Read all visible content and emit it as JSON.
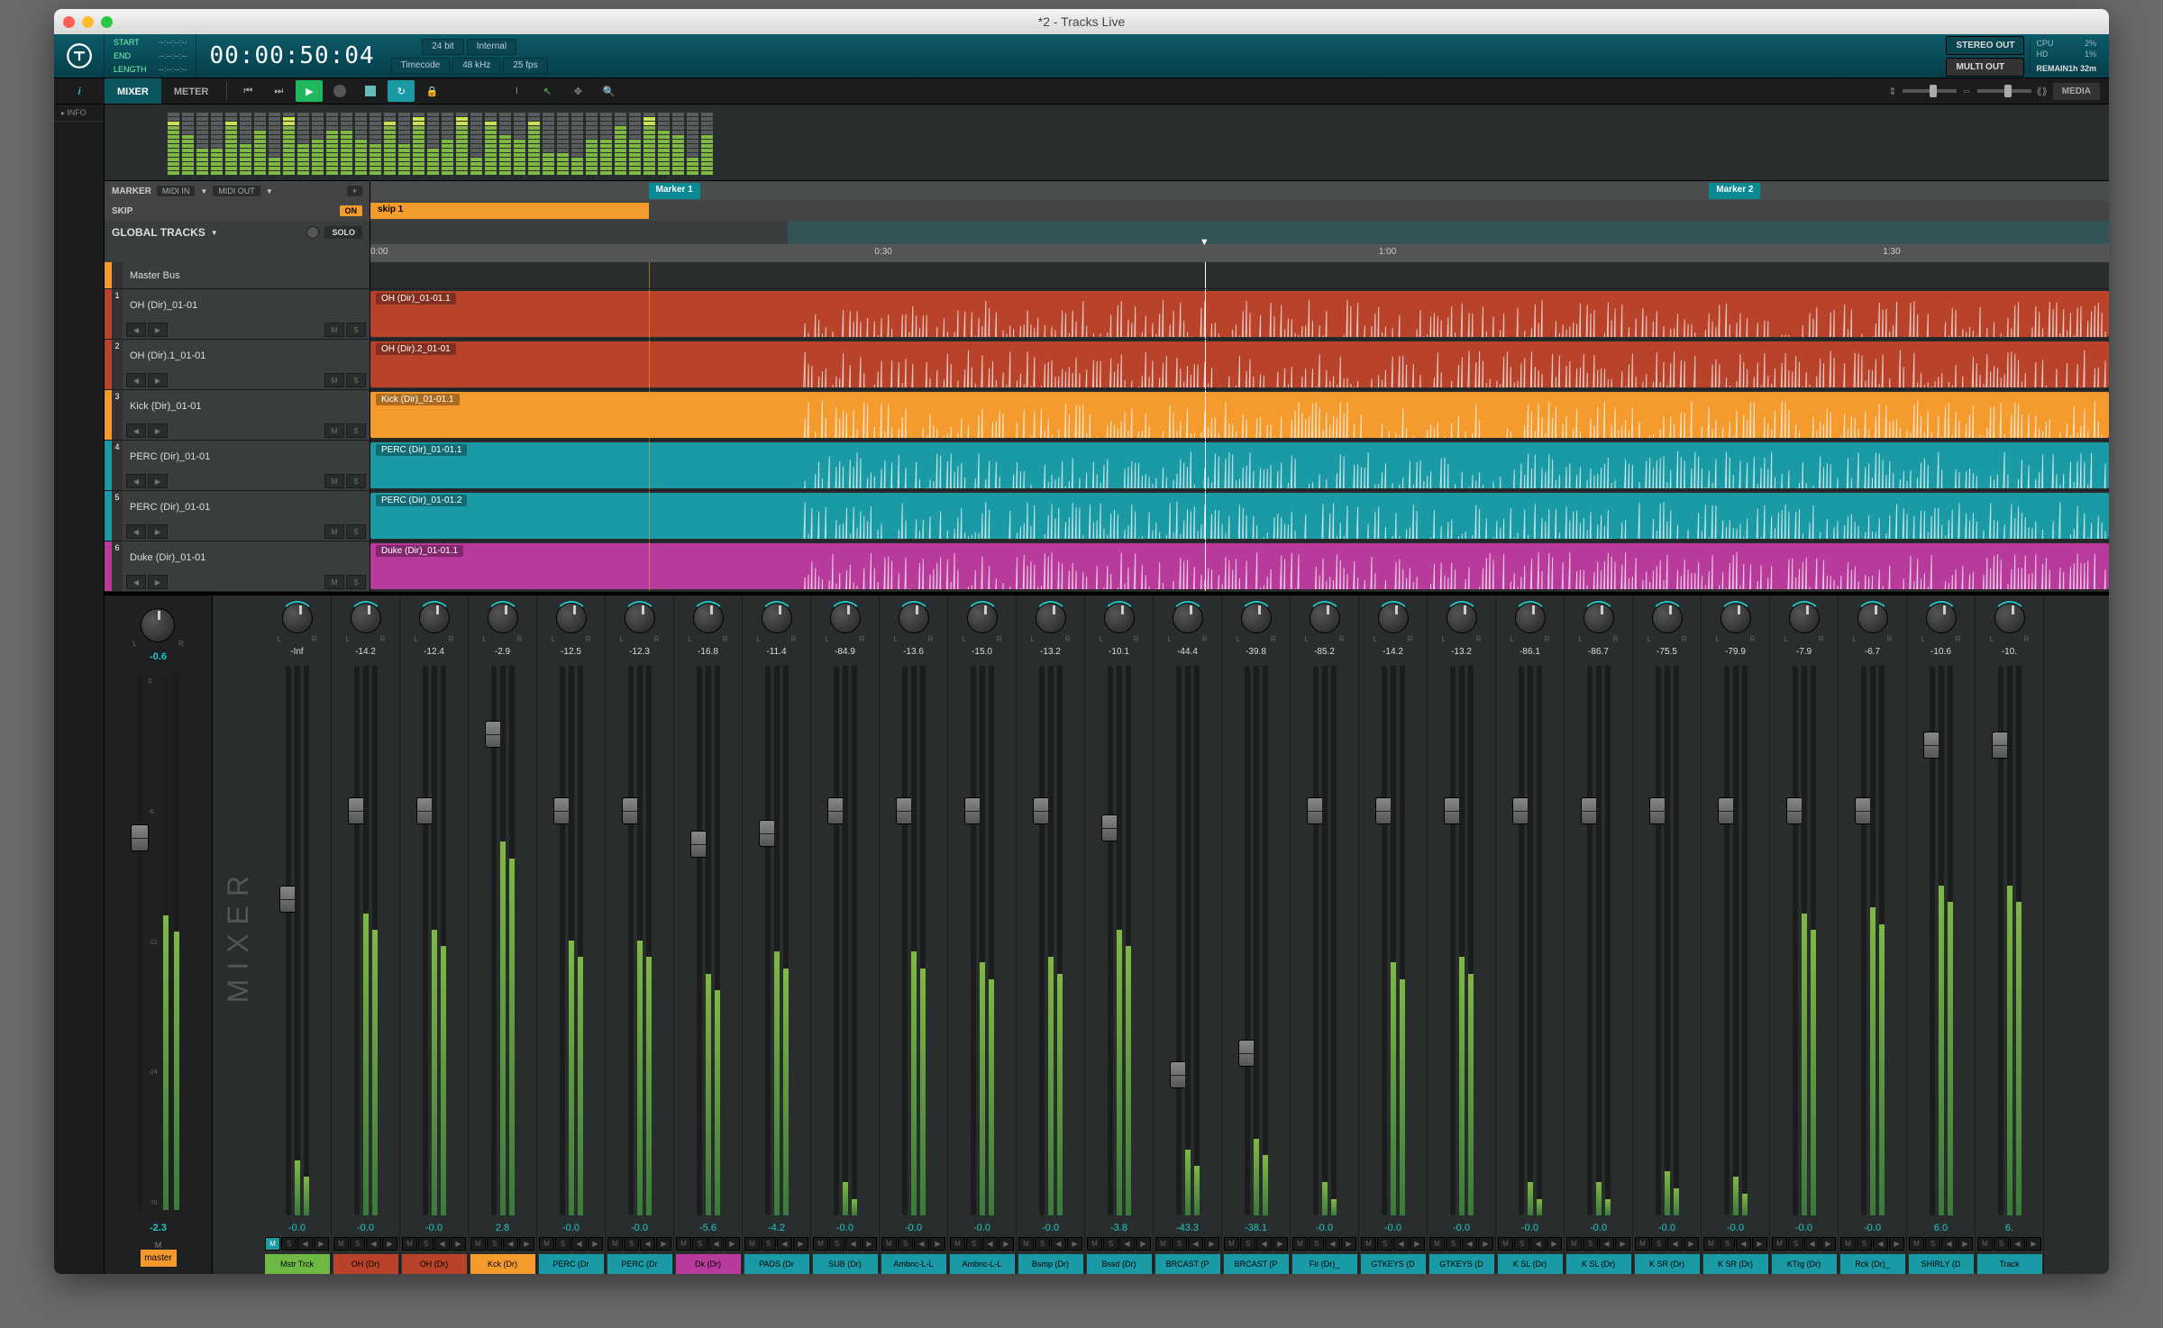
{
  "window": {
    "title": "*2 - Tracks Live"
  },
  "transport": {
    "start_label": "START",
    "start": "--:--:--:--",
    "end_label": "END",
    "end": "--:--:--:--",
    "length_label": "LENGTH",
    "length": "--:--:--:--",
    "timecode": "00:00:50:04",
    "bit": "24 bit",
    "clock": "Internal",
    "tc_label": "Timecode",
    "rate": "48 kHz",
    "fps": "25 fps",
    "stereo": "STEREO OUT",
    "multi": "MULTI OUT",
    "cpu_label": "CPU",
    "cpu": "2%",
    "hd_label": "HD",
    "hd": "1%",
    "remain_label": "REMAIN",
    "remain": "1h 32m"
  },
  "tabs": {
    "info": "INFO",
    "mixer": "MIXER",
    "meter": "METER",
    "media": "MEDIA"
  },
  "timeline": {
    "marker_label": "MARKER",
    "midi_in": "MIDI IN",
    "midi_out": "MIDI OUT",
    "skip_label": "SKIP",
    "on": "ON",
    "skip1": "skip 1",
    "global": "GLOBAL TRACKS",
    "solo": "SOLO",
    "markers": [
      {
        "label": "Marker 1",
        "pos": 16
      },
      {
        "label": "Marker 2",
        "pos": 77
      }
    ],
    "ruler": [
      {
        "t": "0:00",
        "p": 0
      },
      {
        "t": "0:30",
        "p": 29
      },
      {
        "t": "1:00",
        "p": 58
      },
      {
        "t": "1:30",
        "p": 87
      }
    ],
    "playhead": 48,
    "region": {
      "start": 24,
      "end": 100
    },
    "skip_region": {
      "start": 0,
      "end": 16
    }
  },
  "tracks": [
    {
      "n": "",
      "name": "Master Bus",
      "color": "#f59b2e",
      "clip": "",
      "cc": "",
      "master": true
    },
    {
      "n": "1",
      "name": "OH (Dir)_01-01",
      "color": "#b8432a",
      "clip": "OH (Dir)_01-01.1",
      "cc": "#b8432a"
    },
    {
      "n": "2",
      "name": "OH (Dir).1_01-01",
      "color": "#b8432a",
      "clip": "OH (Dir).2_01-01",
      "cc": "#b8432a"
    },
    {
      "n": "3",
      "name": "Kick (Dir)_01-01",
      "color": "#f59b2e",
      "clip": "Kick (Dir)_01-01.1",
      "cc": "#f59b2e"
    },
    {
      "n": "4",
      "name": "PERC (Dir)_01-01",
      "color": "#1a9aa5",
      "clip": "PERC (Dir)_01-01.1",
      "cc": "#1a9aa5"
    },
    {
      "n": "5",
      "name": "PERC (Dir)_01-01",
      "color": "#1a9aa5",
      "clip": "PERC (Dir)_01-01.2",
      "cc": "#1a9aa5"
    },
    {
      "n": "6",
      "name": "Duke (Dir)_01-01",
      "color": "#b83a9a",
      "clip": "Duke (Dir)_01-01.1",
      "cc": "#b83a9a"
    }
  ],
  "master": {
    "pan": "-0.6",
    "fader": "-2.3",
    "m": "M",
    "label": "master"
  },
  "mixer_label": "MIXER",
  "channels": [
    {
      "db": "-Inf",
      "val": "-0.0",
      "name": "Mstr Trck",
      "color": "#6fb843",
      "m_on": true,
      "fp": 40,
      "mh": 10
    },
    {
      "db": "-14.2",
      "val": "-0.0",
      "name": "OH (Dr)",
      "color": "#b8432a",
      "fp": 24,
      "mh": 55
    },
    {
      "db": "-12.4",
      "val": "-0.0",
      "name": "OH (Dr)",
      "color": "#b8432a",
      "fp": 24,
      "mh": 52
    },
    {
      "db": "-2.9",
      "val": "2.8",
      "name": "Kck (Dr)",
      "color": "#f59b2e",
      "fp": 10,
      "mh": 68
    },
    {
      "db": "-12.5",
      "val": "-0.0",
      "name": "PERC (Dr",
      "color": "#1a9aa5",
      "fp": 24,
      "mh": 50
    },
    {
      "db": "-12.3",
      "val": "-0.0",
      "name": "PERC (Dr",
      "color": "#1a9aa5",
      "fp": 24,
      "mh": 50
    },
    {
      "db": "-16.8",
      "val": "-5.6",
      "name": "Dk (Dr)",
      "color": "#b83a9a",
      "fp": 30,
      "mh": 44
    },
    {
      "db": "-11.4",
      "val": "-4.2",
      "name": "PADS (Dr",
      "color": "#1a9aa5",
      "fp": 28,
      "mh": 48
    },
    {
      "db": "-84.9",
      "val": "-0.0",
      "name": "SUB (Dr)",
      "color": "#1a9aa5",
      "fp": 24,
      "mh": 6
    },
    {
      "db": "-13.6",
      "val": "-0.0",
      "name": "Ambnc-L-L",
      "color": "#1a9aa5",
      "fp": 24,
      "mh": 48
    },
    {
      "db": "-15.0",
      "val": "-0.0",
      "name": "Ambnc-L-L",
      "color": "#1a9aa5",
      "fp": 24,
      "mh": 46
    },
    {
      "db": "-13.2",
      "val": "-0.0",
      "name": "Bsmp (Dr)",
      "color": "#1a9aa5",
      "fp": 24,
      "mh": 47
    },
    {
      "db": "-10.1",
      "val": "-3.8",
      "name": "Bssd (Dr)",
      "color": "#1a9aa5",
      "fp": 27,
      "mh": 52
    },
    {
      "db": "-44.4",
      "val": "-43.3",
      "name": "BRCAST (P",
      "color": "#1a9aa5",
      "fp": 72,
      "mh": 12
    },
    {
      "db": "-39.8",
      "val": "-38.1",
      "name": "BRCAST (P",
      "color": "#1a9aa5",
      "fp": 68,
      "mh": 14
    },
    {
      "db": "-85.2",
      "val": "-0.0",
      "name": "Flr (Dr)_",
      "color": "#1a9aa5",
      "fp": 24,
      "mh": 6
    },
    {
      "db": "-14.2",
      "val": "-0.0",
      "name": "GTKEYS (D",
      "color": "#1a9aa5",
      "fp": 24,
      "mh": 46
    },
    {
      "db": "-13.2",
      "val": "-0.0",
      "name": "GTKEYS (D",
      "color": "#1a9aa5",
      "fp": 24,
      "mh": 47
    },
    {
      "db": "-86.1",
      "val": "-0.0",
      "name": "K SL (Dr)",
      "color": "#1a9aa5",
      "fp": 24,
      "mh": 6
    },
    {
      "db": "-86.7",
      "val": "-0.0",
      "name": "K SL (Dr)",
      "color": "#1a9aa5",
      "fp": 24,
      "mh": 6
    },
    {
      "db": "-75.5",
      "val": "-0.0",
      "name": "K SR (Dr)",
      "color": "#1a9aa5",
      "fp": 24,
      "mh": 8
    },
    {
      "db": "-79.9",
      "val": "-0.0",
      "name": "K SR (Dr)",
      "color": "#1a9aa5",
      "fp": 24,
      "mh": 7
    },
    {
      "db": "-7.9",
      "val": "-0.0",
      "name": "KTrg (Dr)",
      "color": "#1a9aa5",
      "fp": 24,
      "mh": 55
    },
    {
      "db": "-6.7",
      "val": "-0.0",
      "name": "Rck (Dr)_",
      "color": "#1a9aa5",
      "fp": 24,
      "mh": 56
    },
    {
      "db": "-10.6",
      "val": "6.0",
      "name": "SHIRLY (D",
      "color": "#1a9aa5",
      "fp": 12,
      "mh": 60
    },
    {
      "db": "-10.",
      "val": "6.",
      "name": "Track",
      "color": "#1a9aa5",
      "fp": 12,
      "mh": 60
    }
  ],
  "btns": {
    "m": "M",
    "s": "S"
  }
}
